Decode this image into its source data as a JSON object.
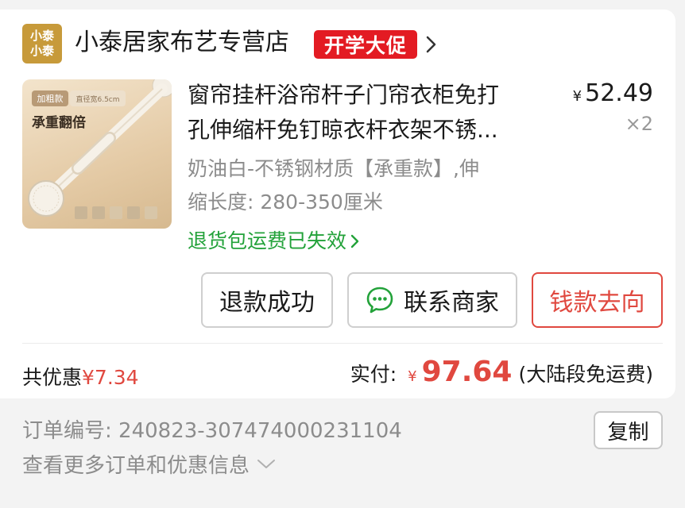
{
  "store": {
    "logo_line1": "小泰",
    "logo_line2": "小泰",
    "name": "小泰居家布艺专营店",
    "promo_badge": "开学大促",
    "chevron_icon": "chevron-right-icon"
  },
  "product": {
    "image_tag1": "加粗款",
    "image_tag2": "直径宽6.5cm",
    "image_heading": "承重翻倍",
    "title_line1": "窗帘挂杆浴帘杆子门帘衣柜免打",
    "title_line2": "孔伸缩杆免钉晾衣杆衣架不锈...",
    "price_symbol": "¥",
    "price": "52.49",
    "quantity": "×2",
    "sku_line1": "奶油白-不锈钢材质【承重款】,伸",
    "sku_line2": "缩长度: 280-350厘米",
    "return_notice": "退货包运费已失效",
    "return_notice_icon": "chevron-right-icon"
  },
  "actions": {
    "refund_label": "退款成功",
    "contact_label": "联系商家",
    "contact_icon": "chat-bubble-icon",
    "money_label": "钱款去向"
  },
  "summary": {
    "discount_label": "共优惠",
    "discount_value": "¥7.34",
    "paid_label": "实付:",
    "paid_symbol": "¥",
    "paid_amount": "97.64",
    "shipping_note": "(大陆段免运费)"
  },
  "order": {
    "number_label": "订单编号:",
    "number_value": "240823-307474000231104",
    "copy_label": "复制",
    "more_label": "查看更多订单和优惠信息",
    "more_icon": "chevron-down-icon"
  },
  "colors": {
    "accent_red": "#e0483f",
    "promo_red": "#e31b23",
    "green": "#23a23a",
    "logo_gold": "#c79a3a"
  }
}
